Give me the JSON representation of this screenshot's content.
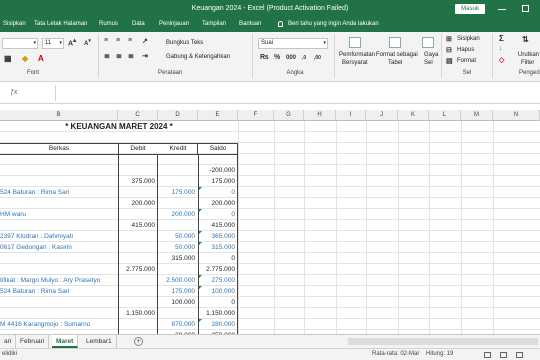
{
  "window": {
    "title": "Keuangan 2024  -  Excel (Product Activation Failed)",
    "signin_label": "Masuk"
  },
  "tabs": [
    "Sisipkan",
    "Tata Letak Halaman",
    "Rumus",
    "Data",
    "Peninjauan",
    "Tampilan",
    "Bantuan"
  ],
  "tell_me": "Beri tahu yang ingin Anda lakukan",
  "ribbon": {
    "font_size": "11",
    "wrap_text": "Bungkus Teks",
    "merge_center": "Gabung & Ketengahkan",
    "number_format": "Suai",
    "conditional_format": [
      "Pemformatan",
      "Bersyarat"
    ],
    "format_table": [
      "Format sebagai",
      "Tabel"
    ],
    "cell_styles": [
      "Gaya",
      "Sel"
    ],
    "insert": "Sisipkan",
    "delete": "Hapus",
    "format": "Format",
    "sort_filter": [
      "Urutkan",
      "Filter"
    ],
    "groups": {
      "font": "Font",
      "alignment": "Perataan",
      "number": "Angka",
      "cells": "Sel",
      "editing": "Penged"
    },
    "percent": "%",
    "comma": "000",
    "dec_inc": ",0",
    "dec_dec": ",00",
    "sigma": "Σ"
  },
  "columns": [
    "B",
    "C",
    "D",
    "E",
    "F",
    "G",
    "H",
    "I",
    "J",
    "K",
    "L",
    "M",
    "N"
  ],
  "sheet": {
    "title": "* KEUANGAN MARET 2024 *",
    "headers": {
      "berkas": "Berkas",
      "debit": "Debit",
      "kredit": "Kredit",
      "saldo": "Saldo"
    },
    "rows": [
      {
        "b": "",
        "c": "",
        "d": "",
        "e": "",
        "blue": false
      },
      {
        "b": "",
        "c": "",
        "d": "",
        "e": "-200.000",
        "blue": false
      },
      {
        "b": "",
        "c": "375.000",
        "d": "",
        "e": "175.000",
        "blue": false
      },
      {
        "b": "524 Baturan : Rima Sari",
        "c": "",
        "d": "175.000",
        "e": "0",
        "blue": true
      },
      {
        "b": "",
        "c": "200.000",
        "d": "",
        "e": "200.000",
        "blue": false
      },
      {
        "b": "HM waru",
        "c": "",
        "d": "200.000",
        "e": "0",
        "blue": true
      },
      {
        "b": "",
        "c": "415.000",
        "d": "",
        "e": "415.000",
        "blue": false
      },
      {
        "b": "2397 Klodran : Dahmiyati",
        "c": "",
        "d": "50.000",
        "e": "365.000",
        "blue": true
      },
      {
        "b": "0617 Gedongan : Kasirin",
        "c": "",
        "d": "50.000",
        "e": "315.000",
        "blue": true
      },
      {
        "b": "",
        "c": "",
        "d": "315.000",
        "e": "0",
        "blue": false
      },
      {
        "b": "",
        "c": "2.775.000",
        "d": "",
        "e": "2.775.000",
        "blue": false
      },
      {
        "b": "tifikat : Margo Mulyo : Ary Prasetyo",
        "c": "",
        "d": "2.500.000",
        "e": "275.000",
        "blue": true
      },
      {
        "b": "524 Baturan : Rima Sari",
        "c": "",
        "d": "175.000",
        "e": "100.000",
        "blue": true
      },
      {
        "b": "",
        "c": "",
        "d": "100.000",
        "e": "0",
        "blue": false
      },
      {
        "b": "",
        "c": "1.150.000",
        "d": "",
        "e": "1.150.000",
        "blue": false
      },
      {
        "b": "M 4416 Karangmojo : Sumarno",
        "c": "",
        "d": "870.000",
        "e": "280.000",
        "blue": true
      },
      {
        "b": "",
        "c": "",
        "d": "30.000",
        "e": "250.000",
        "blue": false
      },
      {
        "b": "019 Sroyo : Ary Prasetyo",
        "c": "",
        "d": "50.000",
        "e": "200.000",
        "blue": true
      }
    ]
  },
  "sheet_tabs": [
    "ari",
    "Februari",
    "Maret",
    "Lembar1"
  ],
  "active_sheet": "Maret",
  "status": {
    "left": "elidiki",
    "average": "Rata-rata: 02-Mar",
    "count": "Hitung: 19"
  }
}
